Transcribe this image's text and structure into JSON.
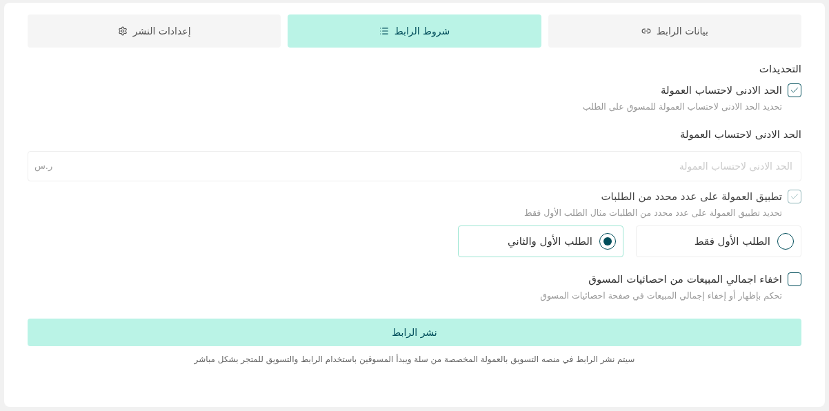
{
  "tabs": [
    {
      "label": "بيانات الرابط",
      "kind": "link",
      "selected": false
    },
    {
      "label": "شروط الرابط",
      "kind": "list",
      "selected": true
    },
    {
      "label": "إعدادات النشر",
      "kind": "gear",
      "selected": false
    }
  ],
  "section_title": "التحديدات",
  "min_commission": {
    "label": "الحد الادنى لاحتساب العمولة",
    "checked": true,
    "disabled": false,
    "hint": "تحديد الحد الادنى لاحتساب العمولة للمسوق على الطلب"
  },
  "min_field": {
    "label": "الحد الادنى لاحتساب العمولة",
    "placeholder": "الحد الادنى لاحتساب العمولة",
    "suffix": "ر.س"
  },
  "order_count": {
    "label": "تطبيق العمولة على عدد محدد من الطلبات",
    "checked": true,
    "disabled": true,
    "hint": "تحديد تطبيق العمولة على عدد محدد من الطلبات مثال الطلب الأول فقط"
  },
  "order_options": [
    {
      "label": "الطلب الأول فقط",
      "selected": false
    },
    {
      "label": "الطلب الأول والثاني",
      "selected": true
    }
  ],
  "hide_sales": {
    "label": "اخفاء اجمالي المبيعات من احصائيات المسوق",
    "checked": false,
    "disabled": false,
    "hint": "تحكم بإظهار أو إخفاء إجمالي المبيعات في صفحة احصائيات المسوق"
  },
  "publish_button": "نشر الرابط",
  "footer_note": "سيتم نشر الرابط في منصه التسويق بالعمولة المخصصة من سلة ويبدأ المسوقين باستخدام الرابط والتسويق للمتجر بشكل مباشر"
}
